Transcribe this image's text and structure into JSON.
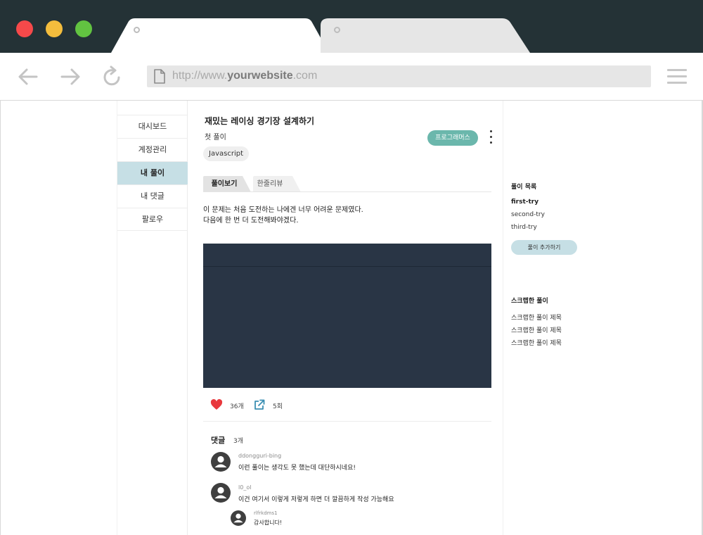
{
  "browser": {
    "url_prefix": "http://www.",
    "url_domain": "yourwebsite",
    "url_suffix": ".com"
  },
  "sidebar": {
    "items": [
      {
        "label": "대시보드",
        "active": false
      },
      {
        "label": "계정관리",
        "active": false
      },
      {
        "label": "내 풀이",
        "active": true
      },
      {
        "label": "내 댓글",
        "active": false
      },
      {
        "label": "팔로우",
        "active": false
      }
    ]
  },
  "post": {
    "title": "재밌는 레이싱 경기장 설계하기",
    "subtitle": "첫 풀이",
    "language_tag": "Javascript",
    "platform_button": "프로그래머스",
    "tabs": [
      {
        "label": "풀이보기",
        "active": true
      },
      {
        "label": "한줄리뷰",
        "active": false
      }
    ],
    "description_line1": "이 문제는 처음 도전하는 나에겐 너무 어려운 문제였다.",
    "description_line2": "다음에 한 번 더 도전해봐야겠다.",
    "likes": "36개",
    "shares": "5회"
  },
  "comments": {
    "title": "댓글",
    "count": "3개",
    "items": [
      {
        "user": "ddongguri-bing",
        "text": "이런 풀이는 생각도 못 했는데 대단하시네요!"
      },
      {
        "user": "l0_ol",
        "text": "이건 여기서 이렇게 저렇게 하면 더 깔끔하게 작성 가능해요"
      },
      {
        "user": "rlfrkdms1",
        "text": "감사합니다!"
      }
    ]
  },
  "right_panel": {
    "solutions_title": "풀이 목록",
    "solutions": [
      "first-try",
      "second-try",
      "third-try"
    ],
    "add_button": "풀이 추가하기",
    "scraps_title": "스크랩한 풀이",
    "scraps": [
      "스크랩한 풀이 제목",
      "스크랩한 풀이 제목",
      "스크랩한 풀이 제목"
    ]
  },
  "colors": {
    "titlebar": "#243236",
    "accent_teal": "#6bb7ac",
    "active_highlight": "#c6dfe5",
    "code_bg": "#293545",
    "heart": "#e8383d",
    "share": "#3b8fb3"
  }
}
